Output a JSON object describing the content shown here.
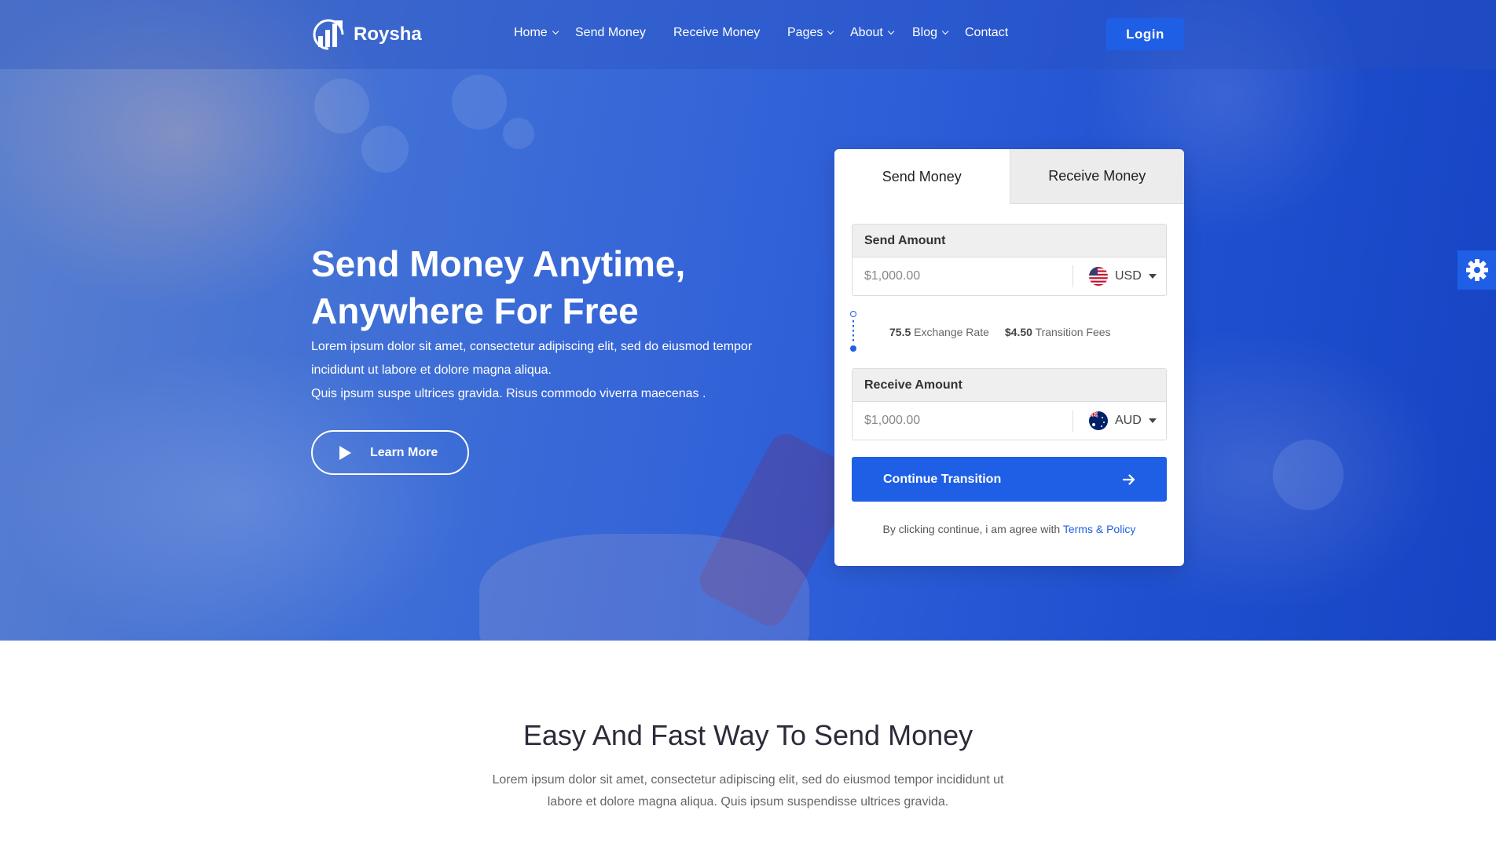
{
  "brand": {
    "name": "Roysha"
  },
  "nav": {
    "items": [
      {
        "label": "Home",
        "dropdown": true
      },
      {
        "label": "Send Money",
        "dropdown": false
      },
      {
        "label": "Receive Money",
        "dropdown": false
      },
      {
        "label": "Pages",
        "dropdown": true
      },
      {
        "label": "About",
        "dropdown": true
      },
      {
        "label": "Blog",
        "dropdown": true
      },
      {
        "label": "Contact",
        "dropdown": false
      }
    ],
    "login_label": "Login"
  },
  "hero": {
    "title_line1": "Send Money Anytime,",
    "title_line2": "Anywhere For Free",
    "desc_line1": "Lorem ipsum dolor sit amet, consectetur adipiscing elit, sed do eiusmod tempor",
    "desc_line2": "incididunt ut labore et dolore magna aliqua.",
    "desc_line3": "Quis ipsum suspe ultrices gravida. Risus commodo viverra maecenas .",
    "cta_label": "Learn More"
  },
  "converter": {
    "tabs": [
      "Send Money",
      "Receive Money"
    ],
    "active_tab": "Send Money",
    "send": {
      "label": "Send Amount",
      "placeholder": "$1,000.00",
      "currency": "USD"
    },
    "receive": {
      "label": "Receive Amount",
      "placeholder": "$1,000.00",
      "currency": "AUD"
    },
    "exchange_rate_value": "75.5",
    "exchange_rate_label": "Exchange Rate",
    "fee_value": "$4.50",
    "fee_label": "Transition Fees",
    "continue_label": "Continue Transition",
    "terms_prefix": "By clicking continue, i am agree with",
    "terms_link": "Terms & Policy"
  },
  "section": {
    "title": "Easy And Fast Way To Send Money",
    "desc_line1": "Lorem ipsum dolor sit amet, consectetur adipiscing elit, sed do eiusmod tempor incididunt ut",
    "desc_line2": "labore et dolore magna aliqua. Quis ipsum suspendisse ultrices gravida."
  },
  "colors": {
    "accent": "#1e5fe6",
    "hero_dark": "#1643c2",
    "hero_light": "#5a7fce"
  },
  "icons": [
    "logo-chart-icon",
    "chevron-down-icon",
    "play-icon",
    "us-flag-icon",
    "au-flag-icon",
    "caret-down-icon",
    "arrow-right-icon",
    "gear-icon"
  ]
}
